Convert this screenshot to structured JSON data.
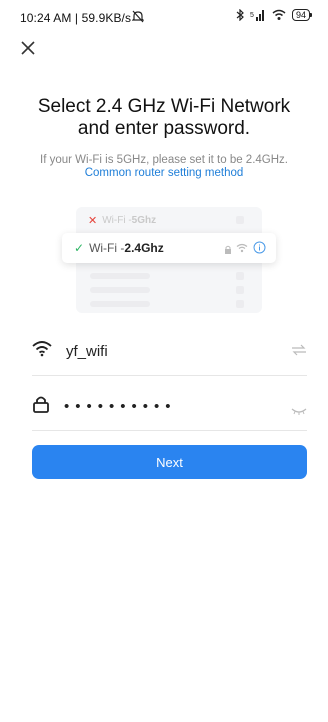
{
  "status_bar": {
    "left_text": "10:24 AM | 59.9KB/s",
    "battery": "94"
  },
  "icons": {
    "close": "close-icon",
    "wifi": "wifi-icon",
    "lock": "lock-icon",
    "switch": "switch-network-icon",
    "eye": "eye-closed-icon"
  },
  "header": {
    "title_line1": "Select 2.4 GHz Wi-Fi Network",
    "title_line2": "and enter password.",
    "subtitle": "If your Wi-Fi is 5GHz, please set it to be 2.4GHz.",
    "link": "Common router setting method"
  },
  "illustration": {
    "wrong_prefix": "Wi-Fi - ",
    "wrong_band": "5Ghz",
    "right_prefix": "Wi-Fi - ",
    "right_band": "2.4Ghz"
  },
  "form": {
    "ssid": "yf_wifi",
    "password_mask": "••••••••••"
  },
  "actions": {
    "next_label": "Next"
  },
  "colors": {
    "accent": "#2a84f0",
    "link": "#1e7ed8",
    "error": "#e5433a",
    "success": "#2db564"
  }
}
